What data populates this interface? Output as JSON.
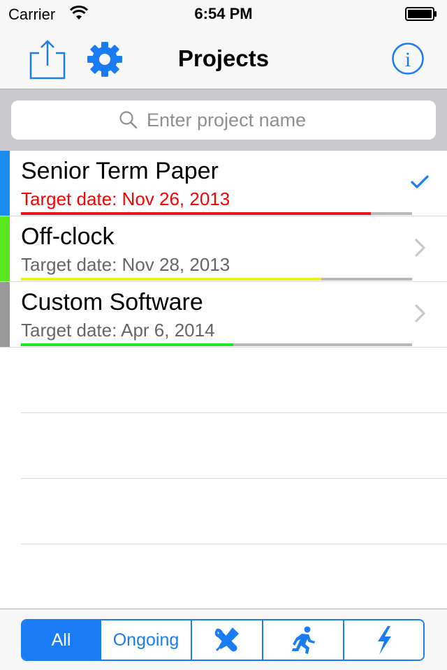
{
  "status_bar": {
    "carrier": "Carrier",
    "time": "6:54 PM"
  },
  "nav": {
    "title": "Projects",
    "left_icons": [
      "share-icon",
      "gear-icon"
    ],
    "right_icon": "info-icon"
  },
  "search": {
    "placeholder": "Enter project name",
    "value": ""
  },
  "projects": [
    {
      "name": "Senior Term Paper",
      "target_date": "Target date: Nov 26, 2013",
      "date_color": "#ff0000",
      "tag_color": "#1a8cf0",
      "progress": 0.895,
      "progress_color": "#e8161c",
      "accessory": "checkmark-icon"
    },
    {
      "name": "Off-clock",
      "target_date": "Target date: Nov 28, 2013",
      "date_color": "#666666",
      "tag_color": "#5ae81c",
      "progress": 0.768,
      "progress_color": "#f0f01e",
      "accessory": "chevron-right-icon"
    },
    {
      "name": "Custom Software",
      "target_date": "Target date: Apr 6, 2014",
      "date_color": "#666666",
      "tag_color": "#999999",
      "progress": 0.543,
      "progress_color": "#1ee81e",
      "accessory": "chevron-right-icon"
    }
  ],
  "filter": {
    "segments": [
      {
        "label": "All",
        "selected": true
      },
      {
        "label": "Ongoing",
        "selected": false
      },
      {
        "icon": "tools-icon",
        "selected": false
      },
      {
        "icon": "running-man-icon",
        "selected": false
      },
      {
        "icon": "lightning-icon",
        "selected": false
      }
    ]
  },
  "colors": {
    "accent": "#1a7cf4",
    "separator": "#d9d9d9"
  }
}
